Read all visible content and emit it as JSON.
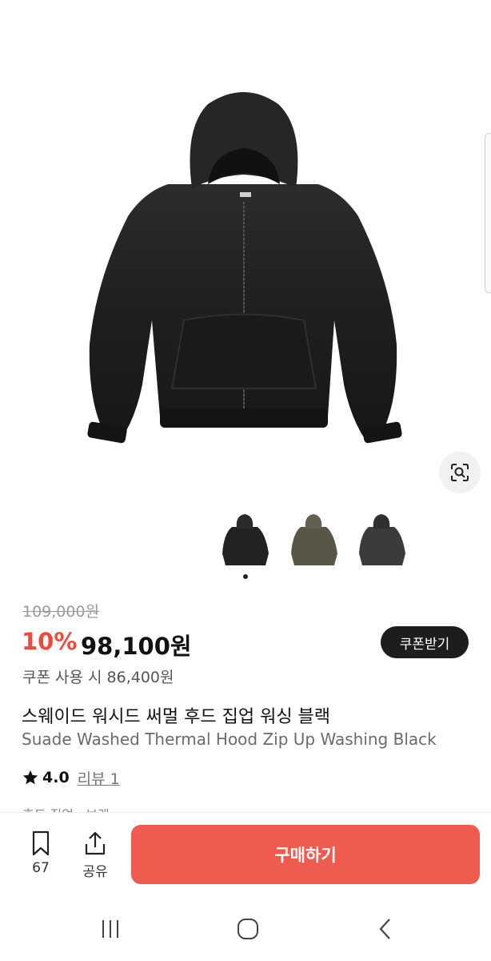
{
  "product": {
    "original_price": "109,000원",
    "discount": "10%",
    "price": "98,100원",
    "coupon_button": "쿠폰받기",
    "coupon_price": "쿠폰 사용 시 86,400원",
    "title_ko": "스웨이드 워시드 써멀 후드 집업 워싱 블랙",
    "title_en": "Suade Washed Thermal Hood Zip Up Washing Black",
    "rating": "4.0",
    "review_link": "리뷰 1",
    "cut_off_text": "후드 집업 · 브랜"
  },
  "gallery": {
    "thumbnail_colors": [
      "#222222",
      "#5a5646",
      "#3a3c3c"
    ],
    "active_index": 0
  },
  "bottom_bar": {
    "bookmark_count": "67",
    "share_label": "공유",
    "buy_label": "구매하기"
  },
  "colors": {
    "accent": "#ef5b4f",
    "discount": "#ef4b3c",
    "dark": "#1d1d1d"
  },
  "icons": {
    "lens": "lens-search-icon",
    "star": "star-icon",
    "bookmark": "bookmark-icon",
    "share": "share-icon",
    "nav_recent": "recent-apps-icon",
    "nav_home": "home-icon",
    "nav_back": "back-icon"
  }
}
